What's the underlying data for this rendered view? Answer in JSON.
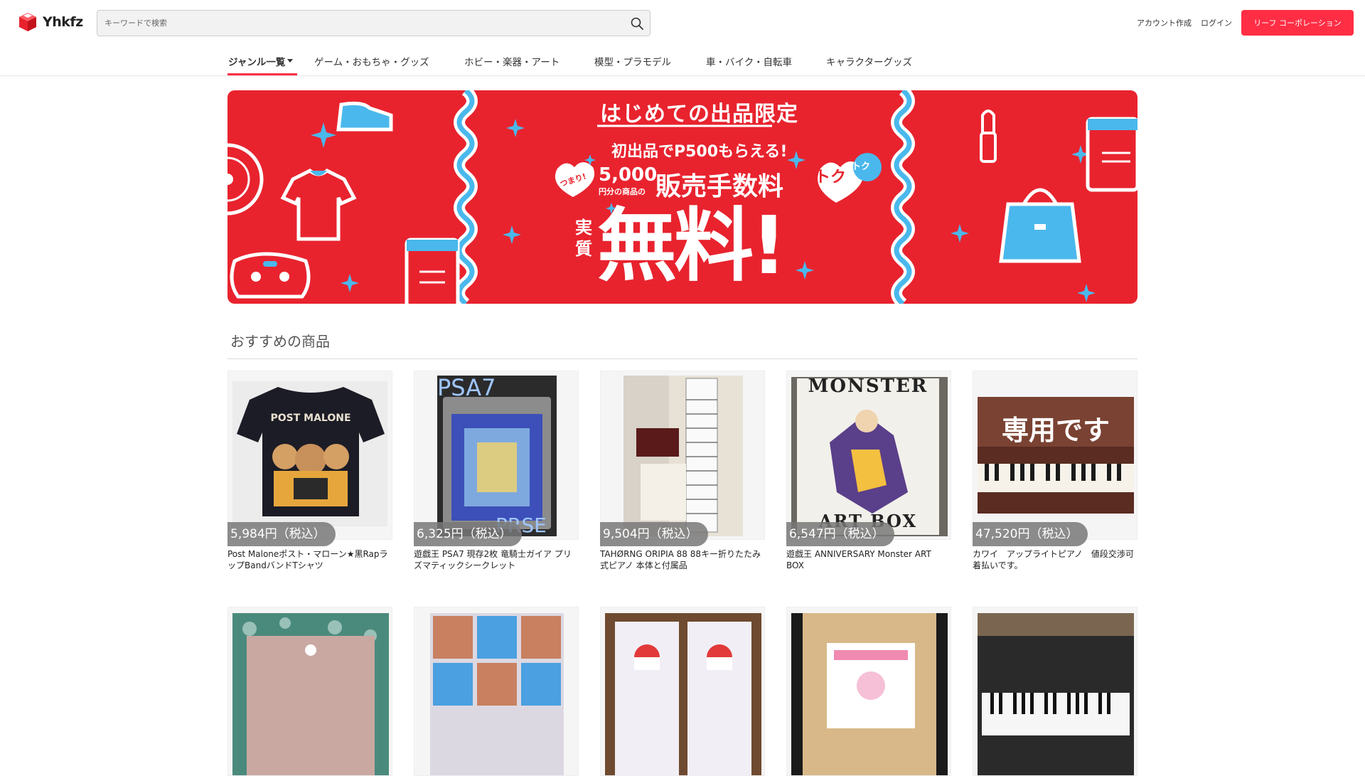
{
  "header": {
    "logo_text": "Yhkfz",
    "search_placeholder": "キーワードで検索",
    "links": [
      "アカウント作成",
      "ログイン"
    ],
    "cta_label": "リーフ コーポレーション"
  },
  "nav": {
    "items": [
      "ジャンル一覧",
      "ゲーム・おもちゃ・グッズ",
      "ホビー・楽器・アート",
      "模型・プラモデル",
      "車・バイク・自転車",
      "キャラクターグッズ"
    ]
  },
  "banner": {
    "title": "はじめての出品限定",
    "subtitle": "初出品でP500もらえる!",
    "badge_left": "つまり!",
    "amount": "5,000",
    "amount_sub": "円分の商品の",
    "fee": "販売手数料",
    "jisshitsu": "実質",
    "free": "無料!",
    "toku_big": "トク",
    "toku_small": "トク"
  },
  "section": {
    "title": "おすすめの商品"
  },
  "products": [
    {
      "price": "5,984円（税込）",
      "name": "Post Maloneポスト・マローン★黒RapラップBandバンドTシャツ"
    },
    {
      "price": "6,325円（税込）",
      "name": "遊戯王 PSA7 現存2枚 竜騎士ガイア プリズマティックシークレット",
      "img_text_top": "PSA7",
      "img_text_bottom": "PRSE"
    },
    {
      "price": "9,504円（税込）",
      "name": "TAHØRNG ORIPIA 88 88キー折りたたみ式ピアノ 本体と付属品"
    },
    {
      "price": "6,547円（税込）",
      "name": "遊戯王 ANNIVERSARY Monster ART BOX",
      "img_text_top": "MONSTER",
      "img_text_bottom": "ART BOX"
    },
    {
      "price": "47,520円（税込）",
      "name": "カワイ　アップライトピアノ　値段交渉可　着払いです。",
      "img_text_top": "専用です"
    }
  ],
  "colors": {
    "accent": "#ff2e44",
    "banner_red": "#e8232e",
    "banner_blue": "#4ab8ec"
  }
}
